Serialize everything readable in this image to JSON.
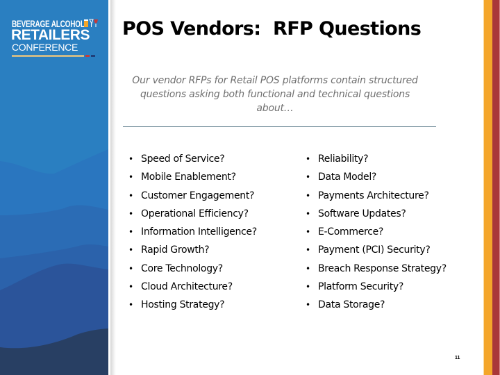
{
  "logo": {
    "line1": "BEVERAGE ALCOHOL",
    "line2": "RETAILERS",
    "line3": "CONFERENCE",
    "icon": "beer-wine-glasses-icon"
  },
  "colors": {
    "sidebar_blue": "#2a7fc1",
    "stripe_orange": "#f4a62a",
    "stripe_red": "#a9373a",
    "divider": "#5e7c8c"
  },
  "title": "POS Vendors:  RFP Questions",
  "subtitle": "Our vendor RFPs for Retail POS platforms contain structured questions asking both functional and technical questions about…",
  "bullet_symbol": "•",
  "left_questions": [
    "Speed of Service?",
    "Mobile Enablement?",
    "Customer Engagement?",
    "Operational Efficiency?",
    "Information Intelligence?",
    "Rapid Growth?",
    "Core Technology?",
    "Cloud Architecture?",
    "Hosting Strategy?"
  ],
  "right_questions": [
    "Reliability?",
    "Data Model?",
    "Payments Architecture?",
    "Software Updates?",
    "E-Commerce?",
    "Payment (PCI) Security?",
    "Breach Response Strategy?",
    "Platform Security?",
    "Data Storage?"
  ],
  "page_number": "11"
}
